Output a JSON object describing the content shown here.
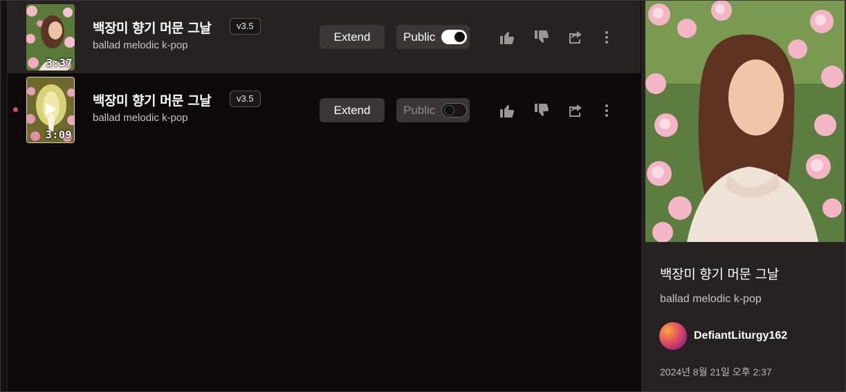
{
  "songs": [
    {
      "title": "백장미 향기 머문 그날",
      "version": "v3.5",
      "style": "ballad melodic k-pop",
      "duration": "3:37",
      "extend_label": "Extend",
      "public_label": "Public",
      "public_on": true,
      "selected": true,
      "playing": false
    },
    {
      "title": "백장미 향기 머문 그날",
      "version": "v3.5",
      "style": "ballad melodic k-pop",
      "duration": "3:09",
      "extend_label": "Extend",
      "public_label": "Public",
      "public_on": false,
      "selected": false,
      "playing": true
    }
  ],
  "detail_panel": {
    "title": "백장미 향기 머문 그날",
    "style": "ballad melodic k-pop",
    "username": "DefiantLiturgy162",
    "created": "2024년 8월 21일 오후 2:37"
  },
  "icons": [
    "thumbs-up-icon",
    "thumbs-down-icon",
    "share-icon",
    "more-options-icon",
    "play-icon"
  ],
  "colors": {
    "background": "#0e090a",
    "row_selected": "#262222",
    "button_bg": "#3a3637",
    "now_playing_dot": "#d24a72"
  }
}
